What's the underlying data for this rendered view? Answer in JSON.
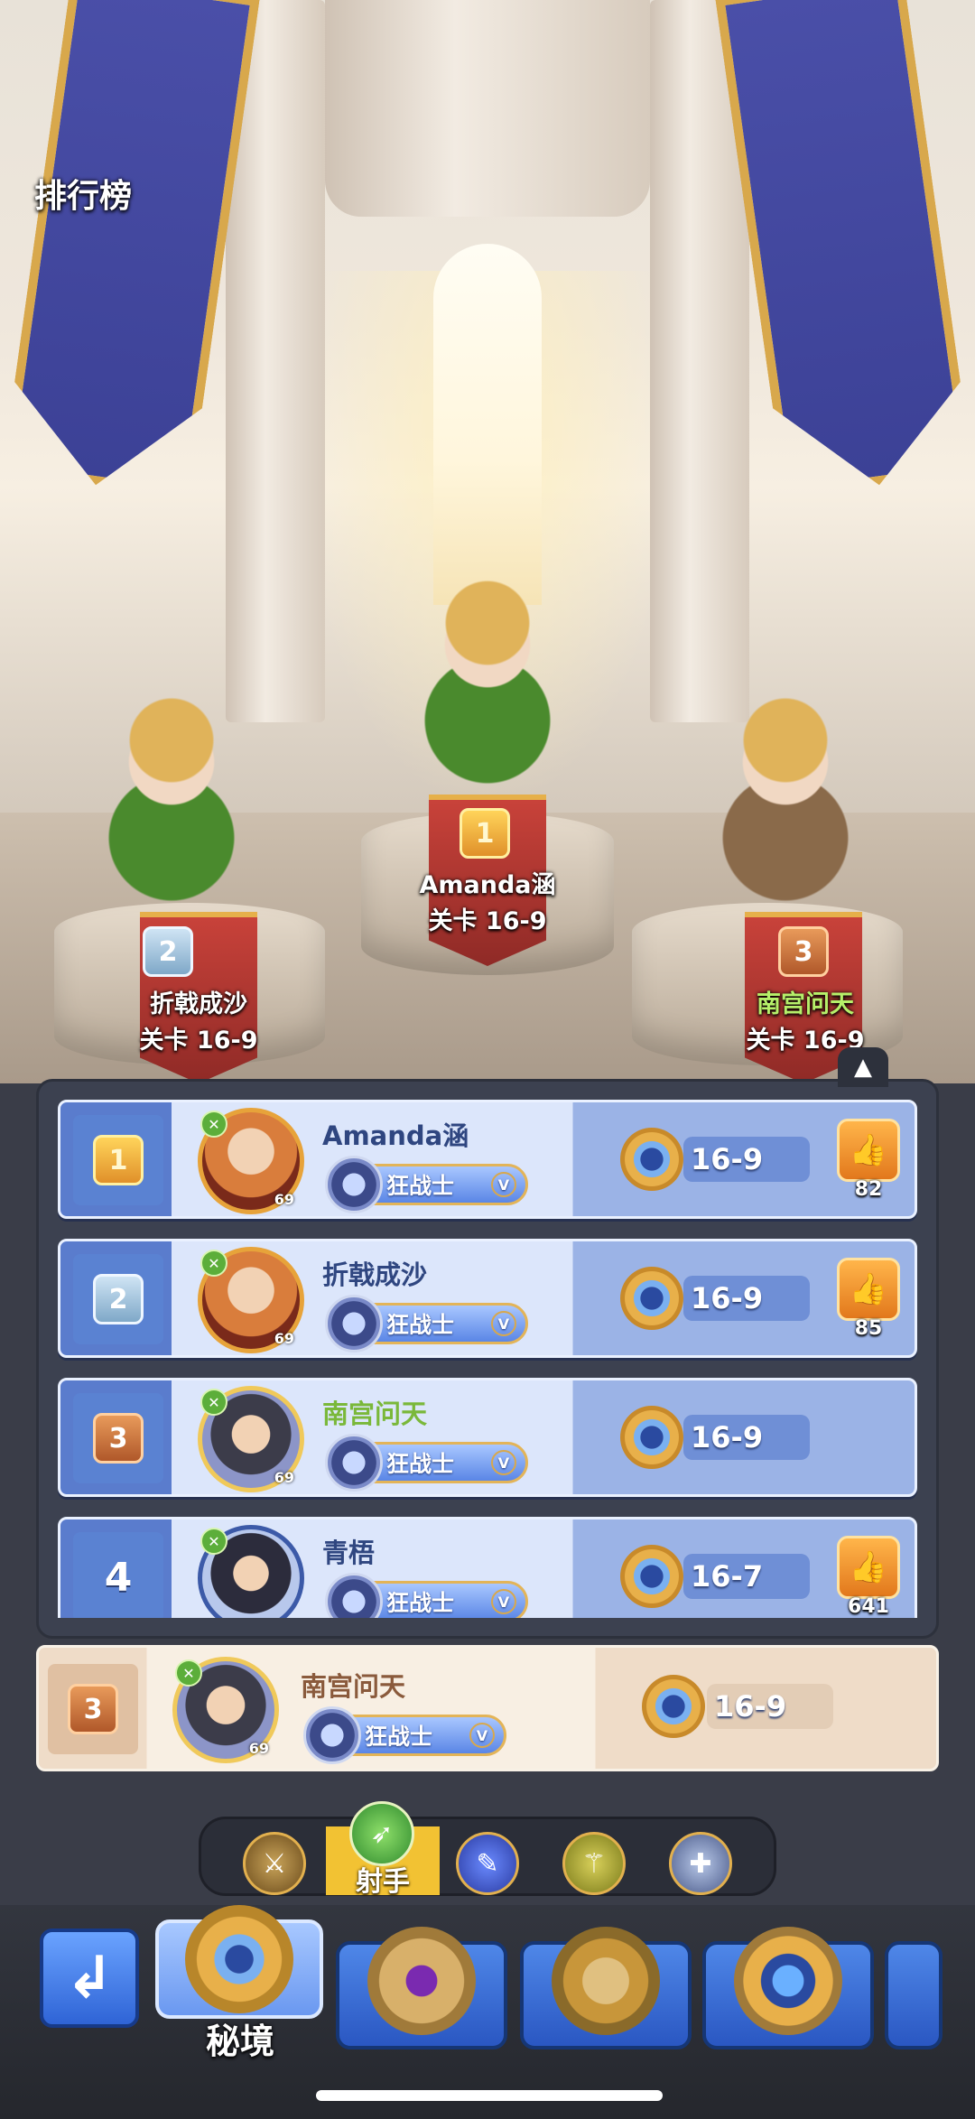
{
  "header": {
    "title": "排行榜"
  },
  "podium": [
    {
      "rank": "2",
      "name": "折戟成沙",
      "stage": "关卡 16-9",
      "name_color": "white"
    },
    {
      "rank": "1",
      "name": "Amanda涵",
      "stage": "关卡 16-9",
      "name_color": "white"
    },
    {
      "rank": "3",
      "name": "南宫问天",
      "stage": "关卡 16-9",
      "name_color": "green"
    }
  ],
  "ranking": {
    "collapse_icon": "▲",
    "rows": [
      {
        "rank": "1",
        "name": "Amanda涵",
        "level": "69",
        "class": "狂战士",
        "class_tier": "V",
        "stage": "16-9",
        "likes": "82"
      },
      {
        "rank": "2",
        "name": "折戟成沙",
        "level": "69",
        "class": "狂战士",
        "class_tier": "V",
        "stage": "16-9",
        "likes": "85"
      },
      {
        "rank": "3",
        "name": "南宫问天",
        "level": "69",
        "class": "狂战士",
        "class_tier": "V",
        "stage": "16-9",
        "likes": ""
      },
      {
        "rank": "4",
        "name": "青梧",
        "level": "",
        "class": "狂战士",
        "class_tier": "V",
        "stage": "16-7",
        "likes": "641"
      }
    ]
  },
  "self_row": {
    "rank": "3",
    "name": "南宫问天",
    "level": "69",
    "class": "狂战士",
    "class_tier": "V",
    "stage": "16-9"
  },
  "class_tabs": {
    "selected_label": "射手",
    "icons": [
      "axe-icon",
      "bow-icon",
      "staff-icon",
      "dagger-icon",
      "cross-icon"
    ]
  },
  "bottom_nav": {
    "back_icon": "return-arrow-icon",
    "active_label": "秘境",
    "modes": [
      "secret-realm",
      "purple-gem-emblem",
      "crown-emblem",
      "star-emblem",
      "more-emblem"
    ]
  },
  "colors": {
    "accent_gold": "#e7a33a",
    "row_blue": "#dce6fb",
    "self_row": "#f8efe3",
    "tab_selected": "#f2c233"
  }
}
